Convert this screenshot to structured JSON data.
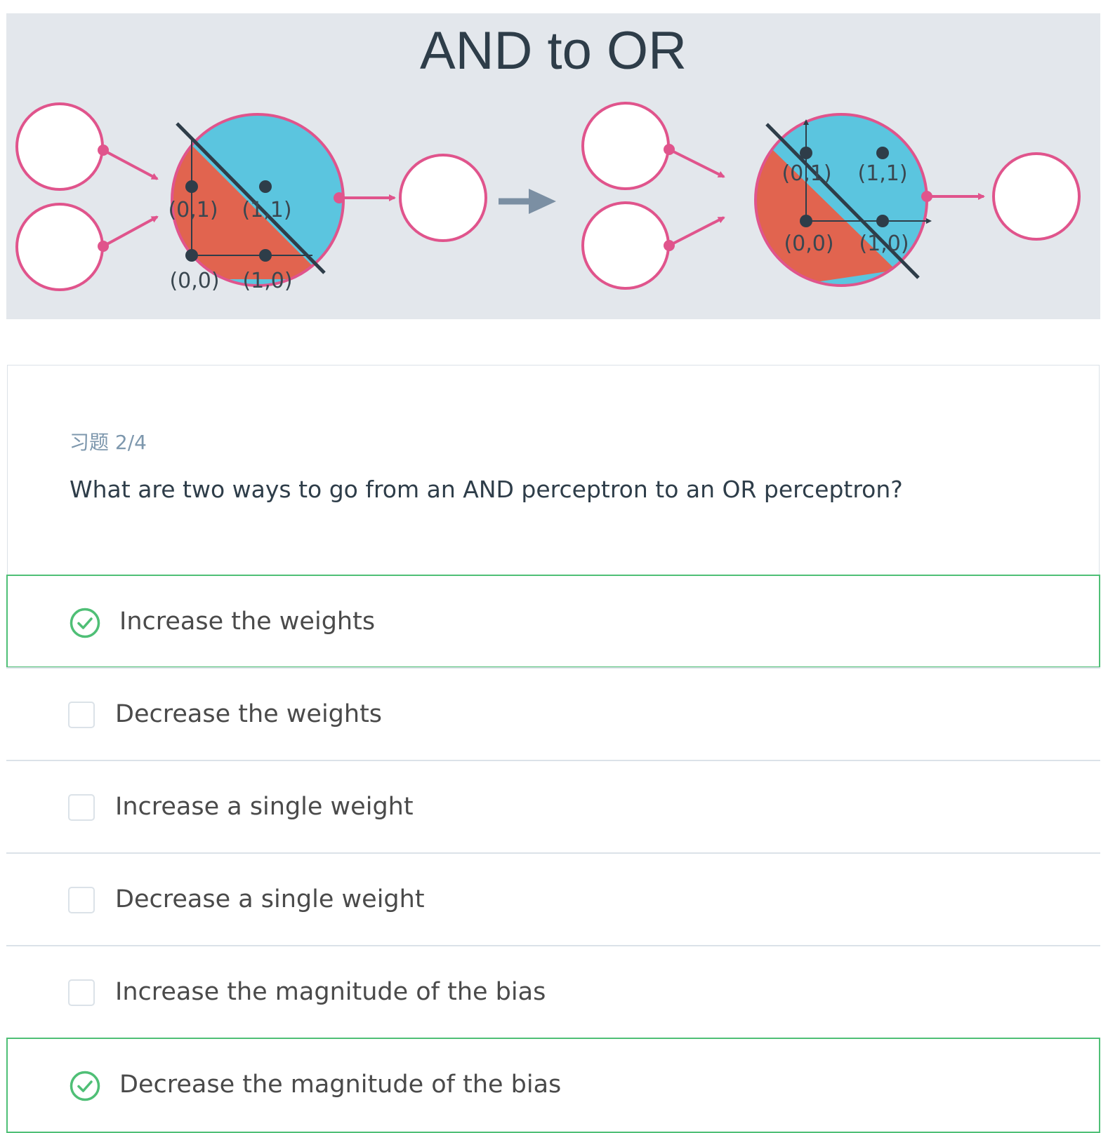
{
  "figure": {
    "title": "AND to OR",
    "and_labels": [
      "(0,1)",
      "(1,1)",
      "(0,0)",
      "(1,0)"
    ],
    "or_labels": [
      "(0,1)",
      "(1,1)",
      "(0,0)",
      "(1,0)"
    ],
    "colors": {
      "background": "#e3e7ec",
      "node_border": "#e0548c",
      "positive_region": "#5bc5df",
      "negative_region": "#e1644f",
      "arrow": "#e0548c",
      "transition_arrow": "#7b8fa3",
      "boundary_line": "#2e3d49"
    }
  },
  "quiz": {
    "counter": "习题 2/4",
    "question": "What are two ways to go from an AND perceptron to an OR perceptron?",
    "options": [
      {
        "label": "Increase the weights",
        "selected": true
      },
      {
        "label": "Decrease the weights",
        "selected": false
      },
      {
        "label": "Increase a single weight",
        "selected": false
      },
      {
        "label": "Decrease a single weight",
        "selected": false
      },
      {
        "label": "Increase the magnitude of the bias",
        "selected": false
      },
      {
        "label": "Decrease the magnitude of the bias",
        "selected": true
      }
    ],
    "colors": {
      "correct": "#4fbf76",
      "border": "#dbe2e8",
      "muted": "#7d97ad"
    }
  }
}
